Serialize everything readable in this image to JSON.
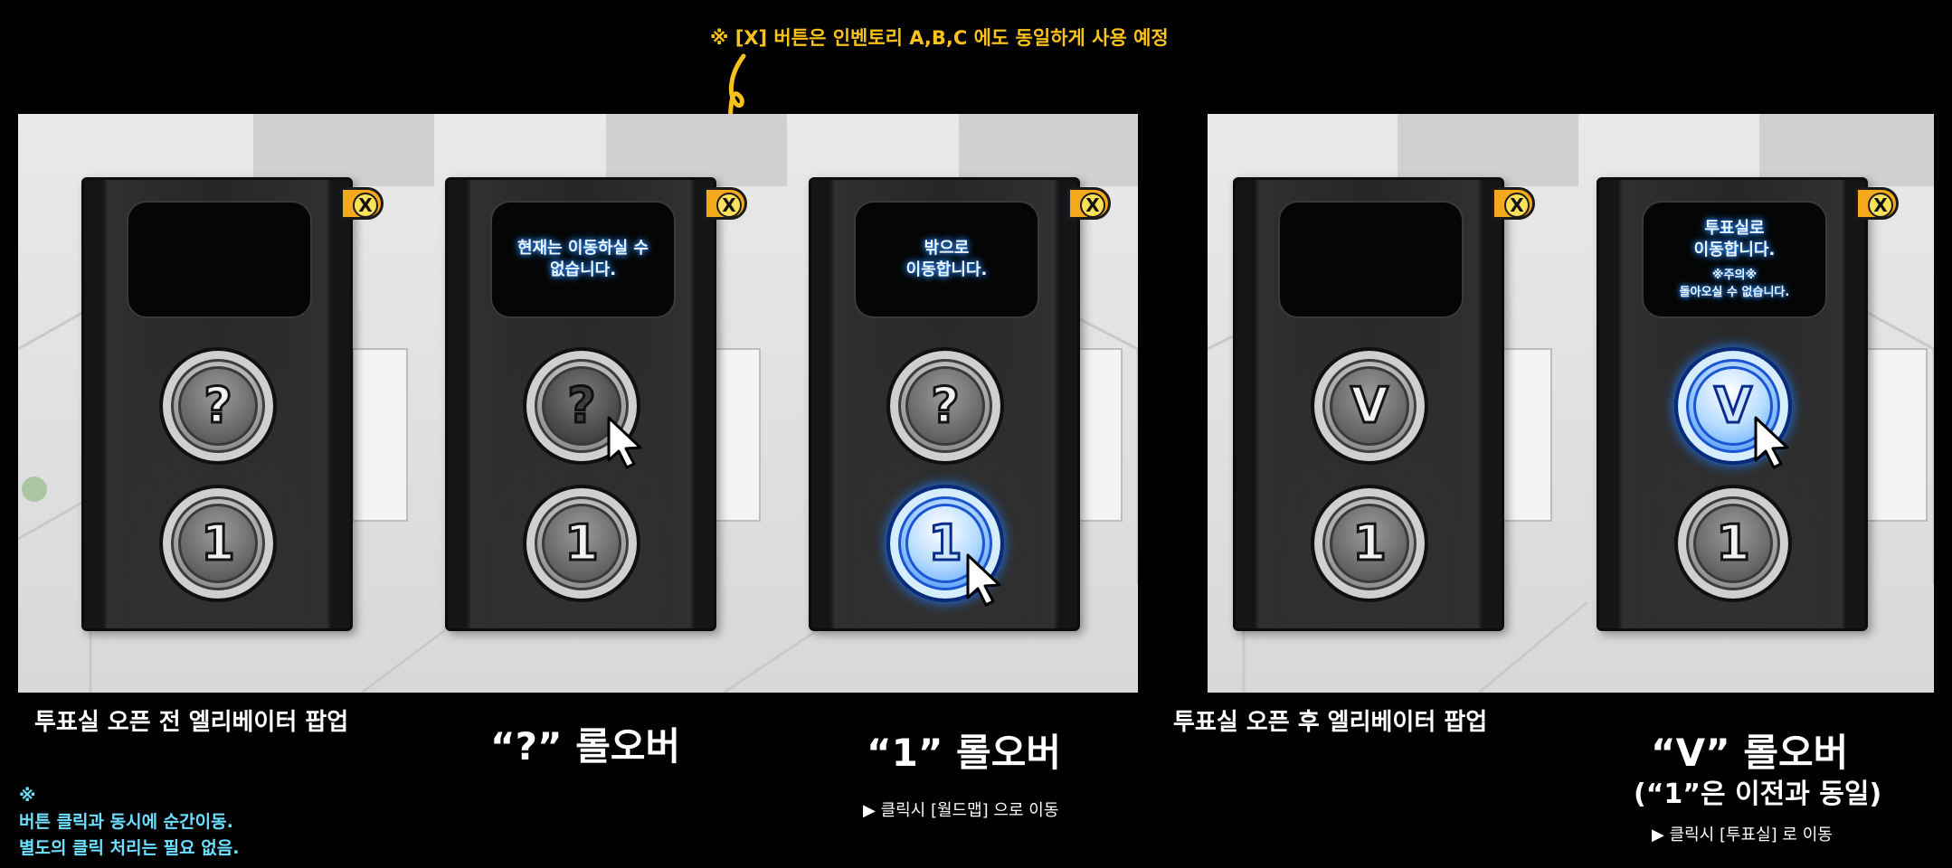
{
  "top_note": "※ [X] 버튼은 인벤토리 A,B,C 에도 동일하게 사용 예정",
  "close_label": "X",
  "elevators": [
    {
      "screen_text": "",
      "screen_warning": "",
      "button_top": "?",
      "button_bottom": "1",
      "state": "default"
    },
    {
      "screen_text": "현재는 이동하실 수\n없습니다.",
      "screen_warning": "",
      "button_top": "?",
      "button_bottom": "1",
      "state": "question-rollover"
    },
    {
      "screen_text": "밖으로\n이동합니다.",
      "screen_warning": "",
      "button_top": "?",
      "button_bottom": "1",
      "state": "one-rollover"
    },
    {
      "screen_text": "",
      "screen_warning": "",
      "button_top": "V",
      "button_bottom": "1",
      "state": "default"
    },
    {
      "screen_text": "투표실로\n이동합니다.",
      "screen_warning": "※주의※\n돌아오실 수 없습니다.",
      "button_top": "V",
      "button_bottom": "1",
      "state": "v-rollover"
    }
  ],
  "captions": {
    "before_open": "투표실 오픈 전 엘리베이터 팝업",
    "question_rollover": "“?” 롤오버",
    "one_rollover": "“1” 롤오버",
    "one_click_note": "▶ 클릭시 [월드맵] 으로 이동",
    "after_open": "투표실 오픈 후 엘리베이터 팝업",
    "v_rollover": "“V” 롤오버",
    "v_rollover_sub": "(“1”은 이전과 동일)",
    "v_click_note": "▶ 클릭시 [투표실] 로 이동"
  },
  "bottom_note": {
    "mark": "※",
    "line1": "버튼 클릭과 동시에 순간이동.",
    "line2": "별도의 클릭 처리는 필요 없음."
  },
  "colors": {
    "note_yellow": "#f9c21a",
    "note_cyan": "#6ee0ff",
    "close_orange": "#f3a91b",
    "glow_blue": "#1f7bff"
  }
}
